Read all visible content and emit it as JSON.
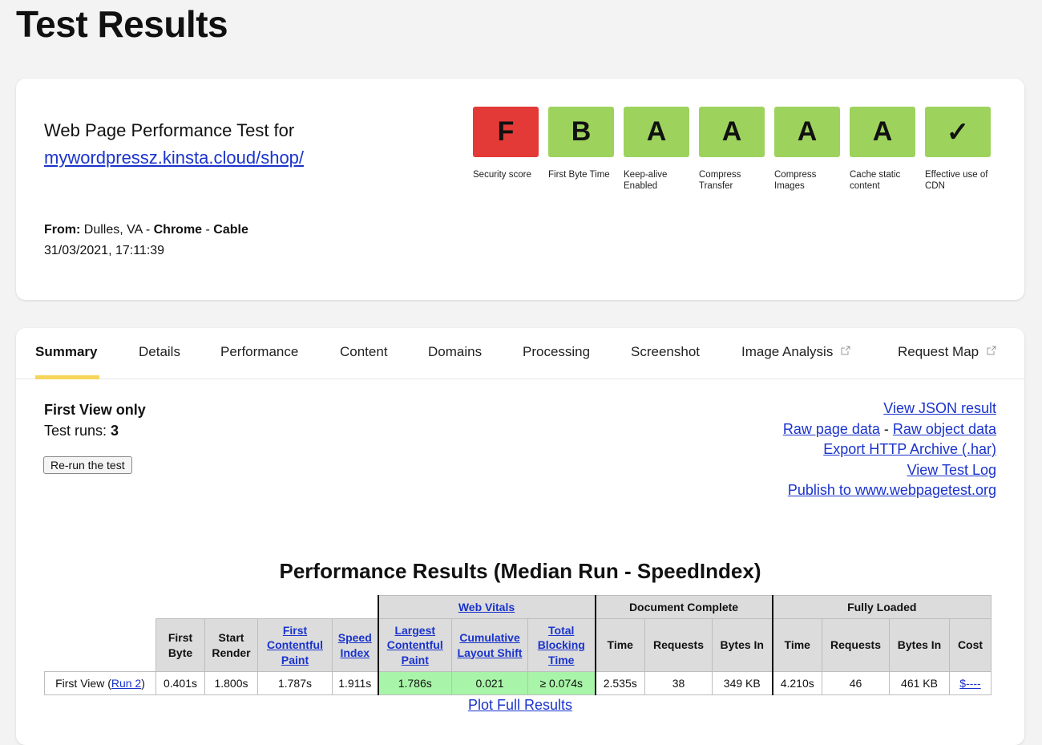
{
  "page": {
    "title": "Test Results"
  },
  "info": {
    "heading": "Web Page Performance Test for",
    "url": "mywordpressz.kinsta.cloud/shop/",
    "from_label": "From:",
    "location": "Dulles, VA",
    "browser": "Chrome",
    "connection": "Cable",
    "sep": " - ",
    "timestamp": "31/03/2021, 17:11:39"
  },
  "grades": [
    {
      "grade": "F",
      "label": "Security score",
      "color": "#e33a37"
    },
    {
      "grade": "B",
      "label": "First Byte Time",
      "color": "#9dd35c"
    },
    {
      "grade": "A",
      "label": "Keep-alive Enabled",
      "color": "#9dd35c"
    },
    {
      "grade": "A",
      "label": "Compress Transfer",
      "color": "#9dd35c"
    },
    {
      "grade": "A",
      "label": "Compress Images",
      "color": "#9dd35c"
    },
    {
      "grade": "A",
      "label": "Cache static content",
      "color": "#9dd35c"
    },
    {
      "grade": "✓",
      "label": "Effective use of CDN",
      "color": "#9dd35c"
    }
  ],
  "tabs": [
    {
      "label": "Summary",
      "active": true
    },
    {
      "label": "Details"
    },
    {
      "label": "Performance"
    },
    {
      "label": "Content"
    },
    {
      "label": "Domains"
    },
    {
      "label": "Processing"
    },
    {
      "label": "Screenshot"
    },
    {
      "label": "Image Analysis",
      "external": true
    },
    {
      "label": "Request Map",
      "external": true
    }
  ],
  "summary": {
    "view_title": "First View only",
    "runs_label": "Test runs: ",
    "runs_value": "3",
    "rerun_button": "Re-run the test"
  },
  "links": {
    "view_json": "View JSON result",
    "raw_page": "Raw page data",
    "separator": " - ",
    "raw_object": "Raw object data",
    "export_har": "Export HTTP Archive (.har)",
    "test_log": "View Test Log",
    "publish": "Publish to www.webpagetest.org"
  },
  "performance": {
    "title": "Performance Results (Median Run - SpeedIndex)",
    "groups": {
      "web_vitals": "Web Vitals",
      "document_complete": "Document Complete",
      "fully_loaded": "Fully Loaded"
    },
    "headers": {
      "first_byte": "First Byte",
      "start_render": "Start Render",
      "fcp": "First Contentful Paint",
      "speed_index": "Speed Index",
      "lcp": "Largest Contentful Paint",
      "cls": "Cumulative Layout Shift",
      "tbt": "Total Blocking Time",
      "dc_time": "Time",
      "dc_requests": "Requests",
      "dc_bytes": "Bytes In",
      "fl_time": "Time",
      "fl_requests": "Requests",
      "fl_bytes": "Bytes In",
      "cost": "Cost"
    },
    "row": {
      "label_prefix": "First View (",
      "run_link": "Run 2",
      "label_suffix": ")",
      "first_byte": "0.401s",
      "start_render": "1.800s",
      "fcp": "1.787s",
      "speed_index": "1.911s",
      "lcp": "1.786s",
      "cls": "0.021",
      "tbt": "≥ 0.074s",
      "dc_time": "2.535s",
      "dc_requests": "38",
      "dc_bytes": "349 KB",
      "fl_time": "4.210s",
      "fl_requests": "46",
      "fl_bytes": "461 KB",
      "cost": "$----"
    },
    "vital_color": "#a8f4a8",
    "plot_link": "Plot Full Results"
  }
}
